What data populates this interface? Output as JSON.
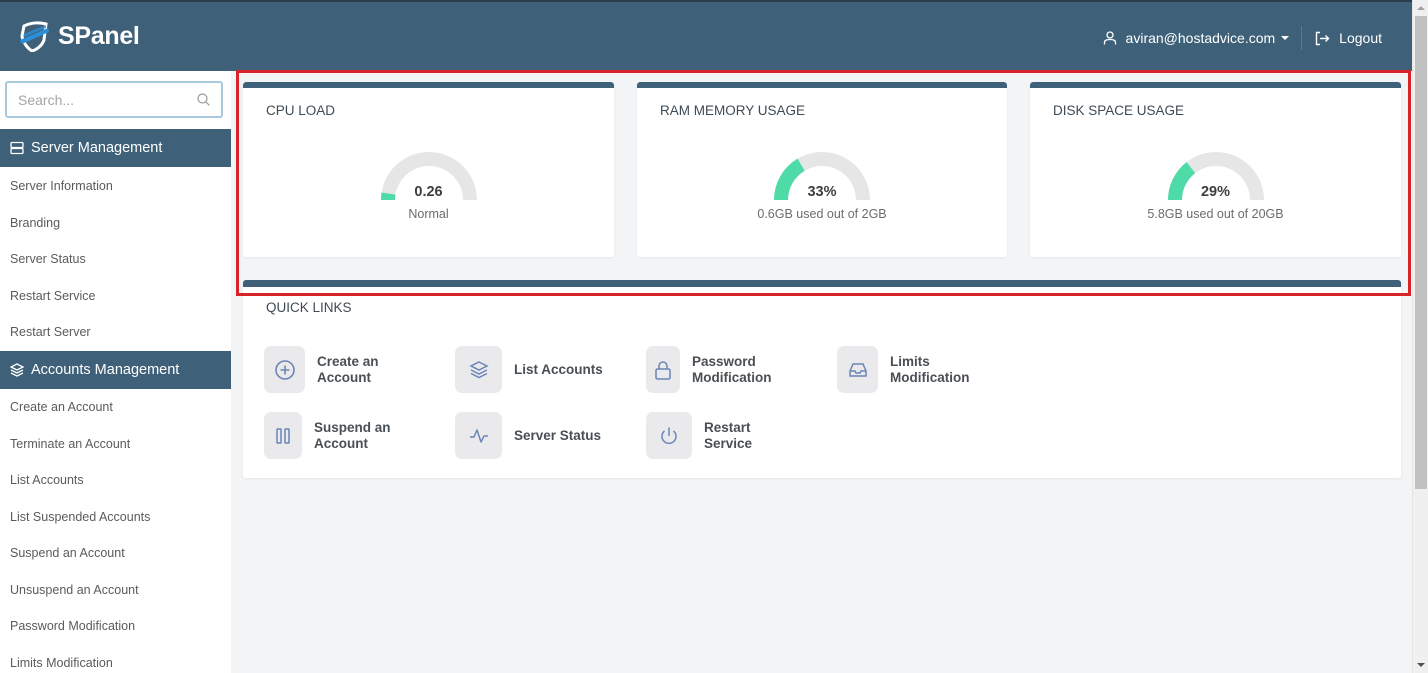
{
  "header": {
    "brand": "SPanel",
    "user_email": "aviran@hostadvice.com",
    "logout_label": "Logout"
  },
  "sidebar": {
    "search_placeholder": "Search...",
    "sections": [
      {
        "title": "Server Management",
        "icon": "server-icon",
        "items": [
          "Server Information",
          "Branding",
          "Server Status",
          "Restart Service",
          "Restart Server"
        ]
      },
      {
        "title": "Accounts Management",
        "icon": "layers-icon",
        "items": [
          "Create an Account",
          "Terminate an Account",
          "List Accounts",
          "List Suspended Accounts",
          "Suspend an Account",
          "Unsuspend an Account",
          "Password Modification",
          "Limits Modification"
        ]
      }
    ]
  },
  "stats": {
    "cpu": {
      "title": "CPU LOAD",
      "value": "0.26",
      "subtitle": "Normal",
      "fraction": 0.05
    },
    "ram": {
      "title": "RAM MEMORY USAGE",
      "value": "33%",
      "subtitle": "0.6GB used out of 2GB",
      "fraction": 0.33
    },
    "disk": {
      "title": "DISK SPACE USAGE",
      "value": "29%",
      "subtitle": "5.8GB used out of 20GB",
      "fraction": 0.29
    }
  },
  "colors": {
    "primary": "#3e6179",
    "gauge_fill": "#4fdba8",
    "gauge_track": "#e6e6e6",
    "highlight": "#d8232a"
  },
  "quick_links": {
    "title": "QUICK LINKS",
    "items": [
      {
        "label": "Create an Account",
        "icon": "plus-circle-icon"
      },
      {
        "label": "List Accounts",
        "icon": "layers-icon"
      },
      {
        "label": "Password Modification",
        "icon": "lock-icon"
      },
      {
        "label": "Limits Modification",
        "icon": "inbox-icon"
      },
      {
        "label": "Suspend an Account",
        "icon": "pause-icon"
      },
      {
        "label": "Server Status",
        "icon": "activity-icon"
      },
      {
        "label": "Restart Service",
        "icon": "power-icon"
      }
    ]
  }
}
